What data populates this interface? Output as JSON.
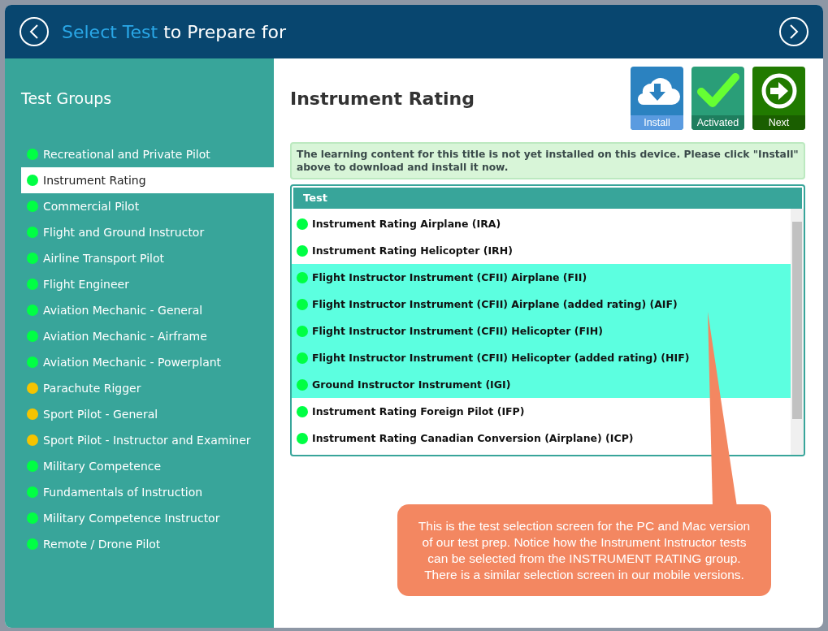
{
  "header": {
    "title_highlight": "Select Test",
    "title_rest": "to Prepare for"
  },
  "sidebar": {
    "title": "Test Groups",
    "items": [
      {
        "label": "Recreational and Private Pilot",
        "color": "#00ff44",
        "selected": false
      },
      {
        "label": "Instrument Rating",
        "color": "#00ff44",
        "selected": true
      },
      {
        "label": "Commercial Pilot",
        "color": "#00ff44",
        "selected": false
      },
      {
        "label": "Flight and Ground Instructor",
        "color": "#00ff44",
        "selected": false
      },
      {
        "label": "Airline Transport Pilot",
        "color": "#00ff44",
        "selected": false
      },
      {
        "label": "Flight Engineer",
        "color": "#00ff44",
        "selected": false
      },
      {
        "label": "Aviation Mechanic - General",
        "color": "#00ff44",
        "selected": false
      },
      {
        "label": "Aviation Mechanic - Airframe",
        "color": "#00ff44",
        "selected": false
      },
      {
        "label": "Aviation Mechanic - Powerplant",
        "color": "#00ff44",
        "selected": false
      },
      {
        "label": "Parachute Rigger",
        "color": "#f5c400",
        "selected": false
      },
      {
        "label": "Sport Pilot - General",
        "color": "#f5c400",
        "selected": false
      },
      {
        "label": "Sport Pilot - Instructor and Examiner",
        "color": "#f5c400",
        "selected": false
      },
      {
        "label": "Military Competence",
        "color": "#00ff44",
        "selected": false
      },
      {
        "label": "Fundamentals of Instruction",
        "color": "#00ff44",
        "selected": false
      },
      {
        "label": "Military Competence Instructor",
        "color": "#00ff44",
        "selected": false
      },
      {
        "label": "Remote / Drone Pilot",
        "color": "#00ff44",
        "selected": false
      }
    ]
  },
  "content": {
    "title": "Instrument Rating",
    "buttons": [
      {
        "kind": "install",
        "label": "Install"
      },
      {
        "kind": "activated",
        "label": "Activated"
      },
      {
        "kind": "next",
        "label": "Next"
      }
    ],
    "notice": "The learning content for this title is not yet installed on this device. Please click \"Install\" above to download and install it now.",
    "table": {
      "columns": [
        "Test"
      ],
      "rows": [
        {
          "label": "Instrument Rating Airplane (IRA)",
          "color": "#00ff44",
          "highlighted": false
        },
        {
          "label": "Instrument Rating Helicopter (IRH)",
          "color": "#00ff44",
          "highlighted": false
        },
        {
          "label": "Flight Instructor Instrument (CFII) Airplane (FII)",
          "color": "#00ff44",
          "highlighted": true
        },
        {
          "label": "Flight Instructor Instrument (CFII) Airplane (added rating) (AIF)",
          "color": "#00ff44",
          "highlighted": true
        },
        {
          "label": "Flight Instructor Instrument (CFII) Helicopter (FIH)",
          "color": "#00ff44",
          "highlighted": true
        },
        {
          "label": "Flight Instructor Instrument (CFII) Helicopter (added rating) (HIF)",
          "color": "#00ff44",
          "highlighted": true
        },
        {
          "label": "Ground Instructor Instrument (IGI)",
          "color": "#00ff44",
          "highlighted": true
        },
        {
          "label": "Instrument Rating Foreign Pilot (IFP)",
          "color": "#00ff44",
          "highlighted": false
        },
        {
          "label": "Instrument Rating Canadian Conversion (Airplane) (ICP)",
          "color": "#00ff44",
          "highlighted": false
        }
      ]
    }
  },
  "callout": {
    "text": "This is the test selection screen for the PC and Mac version of our test prep.  Notice how the Instrument Instructor tests can be selected from the INSTRUMENT RATING group.  There is a similar selection screen in our mobile versions."
  }
}
